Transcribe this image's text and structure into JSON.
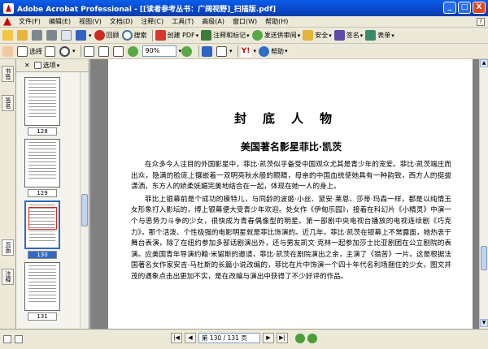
{
  "window": {
    "title": "Adobe Acrobat Professional - [[读者参考丛书：广阔视野]_扫描版.pdf]",
    "buttons": [
      "_",
      "□",
      "X"
    ]
  },
  "menu": [
    "文件(F)",
    "编辑(E)",
    "视图(V)",
    "文档(D)",
    "注释(C)",
    "工具(T)",
    "高级(A)",
    "窗口(W)",
    "帮助(H)"
  ],
  "toolbar1": {
    "stop_label": "回顾",
    "search_label": "搜索",
    "create_pdf_label": "创建 PDF",
    "comment_label": "注释和标记",
    "send_review_label": "发送供审阅",
    "security_label": "安全",
    "sign_label": "签名",
    "forms_label": "表单"
  },
  "toolbar2": {
    "select_label": "选择",
    "zoom_value": "90%",
    "help_label": "帮助",
    "yahoo_label": "Y!"
  },
  "nav_tabs": [
    "书签",
    "签名",
    "页面",
    "注释"
  ],
  "thumbnails": {
    "header_label": "选项",
    "pages": [
      {
        "label": "128",
        "selected": false
      },
      {
        "label": "129",
        "selected": false
      },
      {
        "label": "130",
        "selected": true
      },
      {
        "label": "131",
        "selected": false
      }
    ]
  },
  "document": {
    "heading": "封底人物",
    "subheading": "美国著名影星菲比·凯茨",
    "paragraphs": [
      "在众多今人注目的外国影星中，菲比·凯茨似乎备受中国观众尤其是青少年的宠爱。菲比·凯茨端庄而出众，隐满的脸庞上镶嵌着一双明亮秋水般的眼睛，母亲的中国血统使她具有一种韵致，西方人的挺拔潇洒，东方人的娇柔妩媚完美地结合在一起，体现在她一人的身上。",
      "菲比上银幕前是个成功的模特儿，与同龄的波姬·小丝、黛安·莱恩、莎蒂·玛森一样，都是以纯情玉女形象打入影坛的，博上银幕便大受青少年欢迎。处女作《伊甸乐园》，接着在科幻片《小精灵》中演一个与恶势力斗争的少女，很快成为青春偶像型的明星。第一部剧中央电视台播放的电视连续剧《巧克力》，那个活泼、个性极强的电影明星就是菲比饰演的。近几年，菲比·凯茨在银幕上不常露面，她热衷于舞台表演，除了在纽约参加多部话剧演出外，还与男友凯文·克林一起参加莎士比亚剧团在公立剧院的表演。应美国青年导演约翰·米留斯的邀请，菲比·凯茨在剧院演出之余，主演了《猎苦》一片。这是根据法国著名女作家安吉·马杜斯的长篇小说改编的，菲比在片中饰演一个四十年代名利场捆住的少女，图文并茂的遇象点击出更加不实，是在改编与演出中获得了不少好评的作品。"
    ]
  },
  "statusbar": {
    "page_field": "第 130 / 131 页",
    "first": "|◀",
    "prev": "◀",
    "next": "▶",
    "last": "▶|"
  },
  "colors": {
    "title_bar": "#0846c9",
    "selection": "#3169c6",
    "chrome": "#ece9d8"
  }
}
